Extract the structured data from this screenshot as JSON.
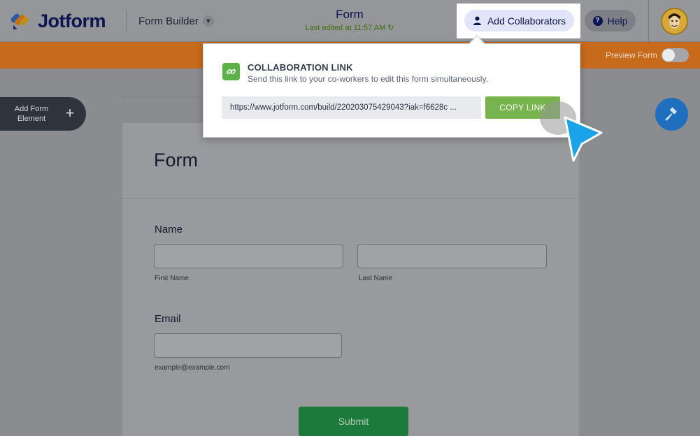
{
  "header": {
    "logo_text": "Jotform",
    "builder_dropdown": "Form Builder",
    "form_title": "Form",
    "last_edited": "Last edited at 11:57 AM",
    "add_collaborators": "Add Collaborators",
    "help": "Help",
    "help_icon_glyph": "?"
  },
  "subbar": {
    "preview_label": "Preview Form",
    "preview_enabled": false
  },
  "sidebar": {
    "add_element_line1": "Add Form",
    "add_element_line2": "Element",
    "plus_glyph": "+"
  },
  "popup": {
    "title": "COLLABORATION LINK",
    "description": "Send this link to your co-workers to edit this form simultaneously.",
    "link_value": "https://www.jotform.com/build/220203075429043?iak=f6628c ...",
    "copy_label": "COPY LINK"
  },
  "form": {
    "title": "Form",
    "name_label": "Name",
    "first_name_sublabel": "First Name",
    "last_name_sublabel": "Last Name",
    "email_label": "Email",
    "email_sublabel": "example@example.com",
    "submit_label": "Submit"
  },
  "colors": {
    "accent_orange": "#c86a1b",
    "copy_green": "#78b44d",
    "submit_green": "#1c7a3d",
    "collab_highlight": "#e2e5f9",
    "cursor_blue": "#1aa3e8"
  },
  "icons": [
    "jotform-logo-icon",
    "chevron-down-icon",
    "refresh-icon",
    "user-icon",
    "help-icon",
    "avatar",
    "plus-icon",
    "paint-roller-icon",
    "link-icon",
    "cursor-arrow-icon"
  ]
}
